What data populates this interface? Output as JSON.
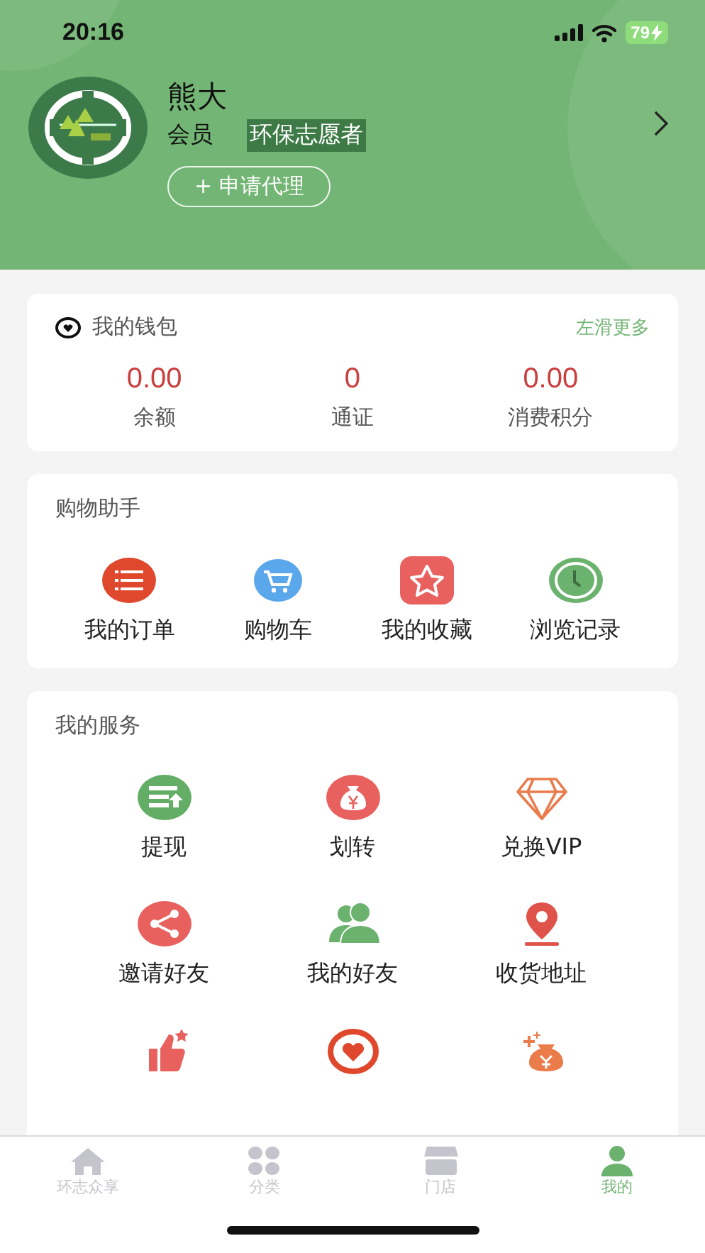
{
  "status_bar": {
    "time": "20:16",
    "battery": "79"
  },
  "profile": {
    "name": "熊大",
    "role": "会员",
    "badge": "环保志愿者",
    "apply_button": "+ 申请代理"
  },
  "wallet": {
    "title": "我的钱包",
    "more": "左滑更多",
    "stats": [
      {
        "value": "0.00",
        "label": "余额"
      },
      {
        "value": "0",
        "label": "通证"
      },
      {
        "value": "0.00",
        "label": "消费积分"
      }
    ]
  },
  "shopping": {
    "title": "购物助手",
    "items": [
      {
        "label": "我的订单"
      },
      {
        "label": "购物车"
      },
      {
        "label": "我的收藏"
      },
      {
        "label": "浏览记录"
      }
    ]
  },
  "services": {
    "title": "我的服务",
    "items": [
      {
        "label": "提现"
      },
      {
        "label": "划转"
      },
      {
        "label": "兑换VIP"
      },
      {
        "label": "邀请好友"
      },
      {
        "label": "我的好友"
      },
      {
        "label": "收货地址"
      }
    ]
  },
  "tabs": [
    {
      "label": "环志众享",
      "selected": false
    },
    {
      "label": "分类",
      "selected": false
    },
    {
      "label": "门店",
      "selected": false
    },
    {
      "label": "我的",
      "selected": true
    }
  ]
}
